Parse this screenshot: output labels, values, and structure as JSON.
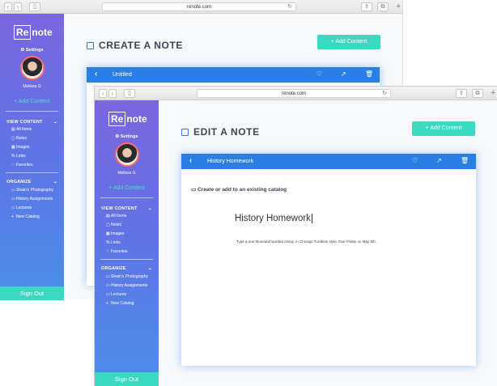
{
  "back_window": {
    "url": "renote.com",
    "logo": {
      "boxed": "Re",
      "rest": "note"
    },
    "settings_label": "Settings",
    "user_name": "Melissa G",
    "add_content_link": "+ Add Content",
    "view_content": {
      "title": "VIEW CONTENT",
      "items": [
        {
          "icon": "▤",
          "label": "All Items"
        },
        {
          "icon": "▢",
          "label": "Notes"
        },
        {
          "icon": "▦",
          "label": "Images"
        },
        {
          "icon": "%",
          "label": "Links"
        },
        {
          "icon": "♡",
          "label": "Favorites"
        }
      ]
    },
    "organize": {
      "title": "ORGANIZE",
      "items": [
        {
          "icon": "▭",
          "label": "Shain's Photography"
        },
        {
          "icon": "▭",
          "label": "History Assignments"
        },
        {
          "icon": "▭",
          "label": "Lectures"
        },
        {
          "icon": "+",
          "label": "New Catalog"
        }
      ]
    },
    "sign_out": "Sign Out",
    "page_title": "CREATE A NOTE",
    "add_content_button": "+ Add Content",
    "editor_title": "Untitled"
  },
  "front_window": {
    "url": "renote.com",
    "logo": {
      "boxed": "Re",
      "rest": "note"
    },
    "settings_label": "Settings",
    "user_name": "Melissa G",
    "add_content_link": "+ Add Content",
    "view_content": {
      "title": "VIEW CONTENT",
      "items": [
        {
          "icon": "▤",
          "label": "All Items"
        },
        {
          "icon": "▢",
          "label": "Notes"
        },
        {
          "icon": "▦",
          "label": "Images"
        },
        {
          "icon": "%",
          "label": "Links"
        },
        {
          "icon": "♡",
          "label": "Favorites"
        }
      ]
    },
    "organize": {
      "title": "ORGANIZE",
      "items": [
        {
          "icon": "▭",
          "label": "Shain's Photography"
        },
        {
          "icon": "▭",
          "label": "History Assignments"
        },
        {
          "icon": "▭",
          "label": "Lectures"
        },
        {
          "icon": "+",
          "label": "New Catalog"
        }
      ]
    },
    "sign_out": "Sign Out",
    "page_title": "EDIT A NOTE",
    "add_content_button": "+ Add Content",
    "editor_title": "History Homework",
    "catalog_prompt": "Create or add to an existing catalog",
    "note_title": "History Homework",
    "note_body": "Type a one thousand worded essay, in Chicago Turabian style. Due Friday on May 5th."
  },
  "icons": {
    "back": "chevron-left-icon",
    "favorite": "heart-icon",
    "share": "share-icon",
    "delete": "trash-icon",
    "settings": "gear-icon",
    "catalog": "folder-icon"
  },
  "colors": {
    "accent_teal": "#3ad9c0",
    "editor_bar_blue": "#2b7ee3",
    "sidebar_top": "#7b66e0",
    "sidebar_bottom": "#4a8fe9"
  }
}
